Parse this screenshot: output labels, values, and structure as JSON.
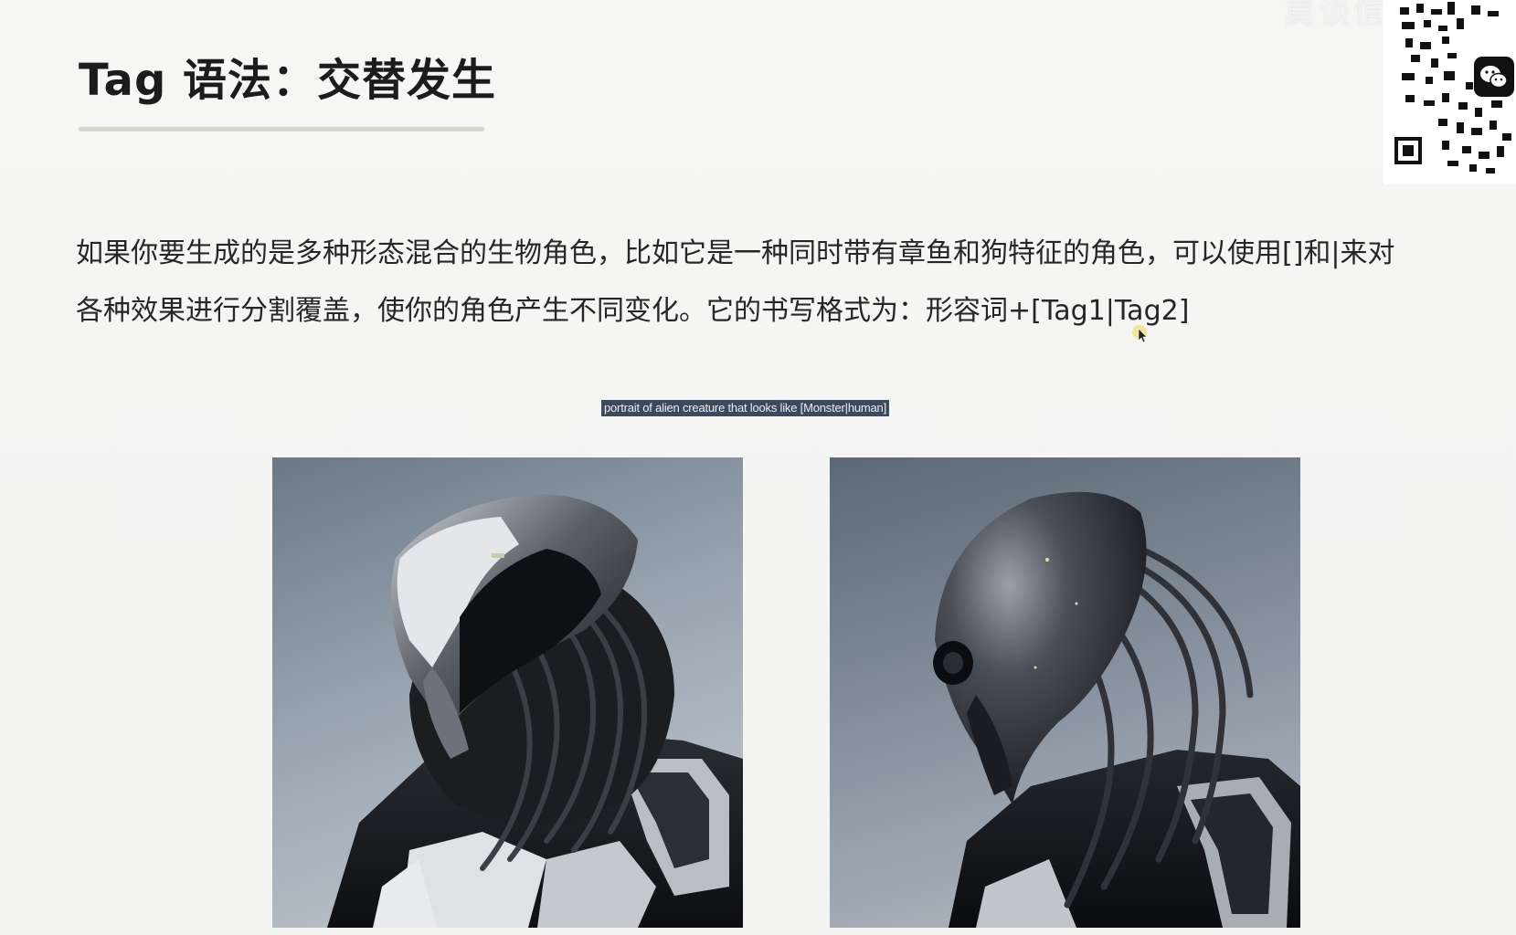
{
  "slide": {
    "title": "Tag 语法：交替发生",
    "paragraph_line1": "如果你要生成的是多种形态混合的生物角色，比如它是一种同时带有章鱼和狗特征的角色，可以使用[]和|来对",
    "paragraph_line2": "各种效果进行分割覆盖，使你的角色产生不同变化。它的书写格式为：形容词+[Tag1|Tag2]",
    "prompt_caption": "portrait of alien creature that looks like [Monster|human]",
    "watermark": "莫谈信"
  },
  "images": {
    "left": {
      "subject": "alien-robot-portrait-image"
    },
    "right": {
      "subject": "alien-creature-portrait-image"
    }
  },
  "icons": {
    "wechat": "wechat-icon",
    "qr": "qr-code",
    "cursor": "mouse-cursor-icon"
  },
  "colors": {
    "background": "#f5f5f4",
    "title_rule": "#d8d6cc",
    "caption_bg": "#3d4a5e",
    "cursor_highlight": "#f3e27a"
  }
}
